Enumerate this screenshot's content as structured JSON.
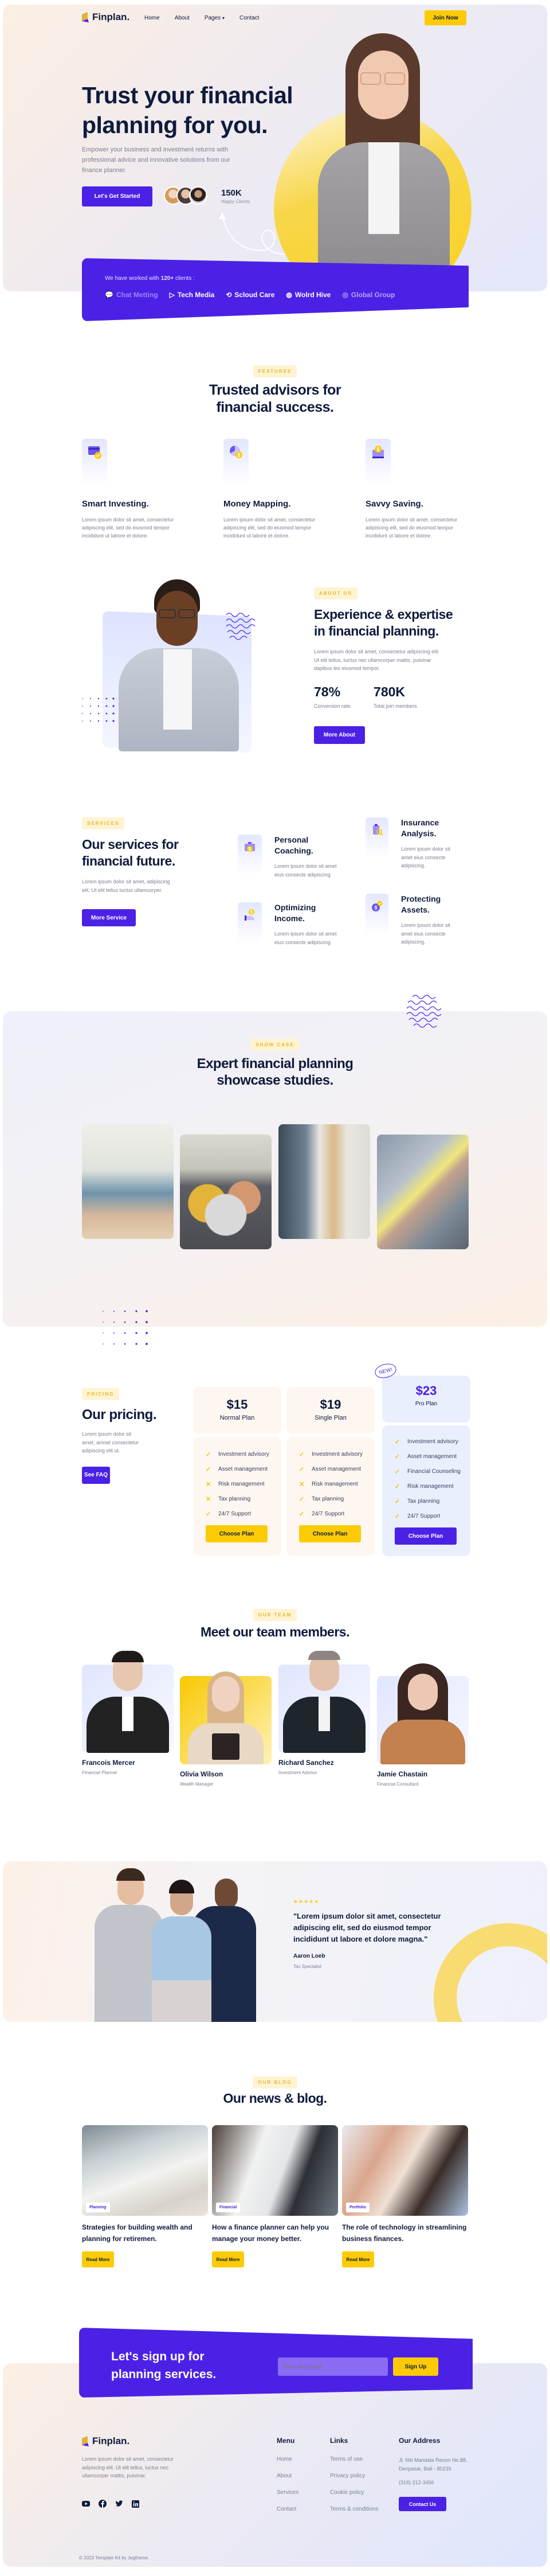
{
  "colors": {
    "primary": "#4b21e6",
    "accent": "#fccb06",
    "navy": "#0f1b3d",
    "muted": "#7b8094",
    "badge_bg": "#fff3d1",
    "badge_text": "#e6b52a"
  },
  "nav": {
    "brand": "Finplan.",
    "links": [
      "Home",
      "About",
      "Pages",
      "Contact"
    ],
    "join_label": "Join Now"
  },
  "hero": {
    "title_line1": "Trust your financial",
    "title_line2": "planning for you.",
    "description": "Empower your business and investment returns with professional advice and innovative solutions from our finance planner.",
    "cta_label": "Let's Get Started",
    "stat_value": "150K",
    "stat_label": "Happy Clients."
  },
  "clients": {
    "intro_prefix": "We have worked with ",
    "intro_count": "120+",
    "intro_suffix": " clients :",
    "logos": [
      {
        "name": "Chat Metting",
        "icon": "chat-bubble-icon"
      },
      {
        "name": "Tech Media",
        "icon": "play-triangle-icon"
      },
      {
        "name": "Scloud Care",
        "icon": "link-swirl-icon"
      },
      {
        "name": "Wolrd Hive",
        "icon": "globe-dots-icon"
      },
      {
        "name": "Global Group",
        "icon": "globe-lines-icon"
      }
    ]
  },
  "features": {
    "badge": "FEATURES",
    "title_line1": "Trusted advisors for",
    "title_line2": "financial success.",
    "items": [
      {
        "title": "Smart Investing.",
        "text": "Lorem ipsum dolor sit amet, consectetur adipiscing elit, sed do eiusmod tempor incididunt ut labore et dolore.",
        "icon": "credit-card-shield-icon"
      },
      {
        "title": "Money Mapping.",
        "text": "Lorem ipsum dolor sit amet, consectetur adipiscing elit, sed do eiusmod tempor incididunt ut labore et dolore.",
        "icon": "pie-chart-coin-icon"
      },
      {
        "title": "Savvy Saving.",
        "text": "Lorem ipsum dolor sit amet, consectetur adipiscing elit, sed do eiusmod tempor incididunt ut labore et dolore.",
        "icon": "wallet-coin-icon"
      }
    ]
  },
  "about": {
    "badge": "ABOUT US",
    "title_line1": "Experience & expertise",
    "title_line2": "in financial planning.",
    "text": "Lorem ipsum dolor sit amet, consectetur adipiscing elit. Ut elit tellus, luctus nec ullamcorper mattis, pulvinar dapibus leo eiusmod tempor.",
    "stats": [
      {
        "value": "78%",
        "label": "Conversion rate."
      },
      {
        "value": "780K",
        "label": "Total join members."
      }
    ],
    "button": "More About"
  },
  "services": {
    "badge": "SERVICES",
    "title_line1": "Our services for",
    "title_line2": "financial future.",
    "text": "Lorem ipsum dolor sit amet, adipiscing elit. Ut elit tellus luctus ullamcorper.",
    "button": "More Service",
    "items": [
      {
        "title_line1": "Personal",
        "title_line2": "Coaching.",
        "text": "Lorem ipsum dolor sit amet eius consecte adipiscing.",
        "icon": "briefcase-coin-icon"
      },
      {
        "title_line1": "Insurance",
        "title_line2": "Analysis.",
        "text": "Lorem ipsum dolor sit amet eius consecte adipiscing.",
        "icon": "document-search-icon"
      },
      {
        "title_line1": "Optimizing",
        "title_line2": "Income.",
        "text": "Lorem ipsum dolor sit amet eius consecte adipiscing.",
        "icon": "hand-coin-icon"
      },
      {
        "title_line1": "Protecting",
        "title_line2": "Assets.",
        "text": "Lorem ipsum dolor sit amet eius consecte adipiscing.",
        "icon": "coin-heart-icon"
      }
    ]
  },
  "showcase": {
    "badge": "SHOW CASE",
    "title_line1": "Expert financial planning",
    "title_line2": "showcase studies."
  },
  "pricing": {
    "badge": "PRICING",
    "title": "Our pricing.",
    "text": "Lorem ipsum dolor sit amet, amnet consectetur adipiscing elit ut.",
    "faq_button": "See FAQ",
    "new_tag": "NEW!",
    "plans": [
      {
        "price": "$15",
        "name": "Normal Plan",
        "button": "Choose Plan",
        "features": [
          {
            "label": "Investment advisory",
            "included": true
          },
          {
            "label": "Asset management",
            "included": true
          },
          {
            "label": "Risk management",
            "included": false
          },
          {
            "label": "Tax planning",
            "included": false
          },
          {
            "label": "24/7 Support",
            "included": true
          }
        ]
      },
      {
        "price": "$19",
        "name": "Single Plan",
        "button": "Choose Plan",
        "features": [
          {
            "label": "Investment advisory",
            "included": true
          },
          {
            "label": "Asset management",
            "included": true
          },
          {
            "label": "Risk management",
            "included": false
          },
          {
            "label": "Tax planning",
            "included": true
          },
          {
            "label": "24/7 Support",
            "included": true
          }
        ]
      },
      {
        "price": "$23",
        "name": "Pro Plan",
        "button": "Choose Plan",
        "features": [
          {
            "label": "Investment advisory",
            "included": true
          },
          {
            "label": "Asset management",
            "included": true
          },
          {
            "label": "Financial Counseling",
            "included": true
          },
          {
            "label": "Risk management",
            "included": true
          },
          {
            "label": "Tax planning",
            "included": true
          },
          {
            "label": "24/7 Support",
            "included": true
          }
        ]
      }
    ]
  },
  "team": {
    "badge": "OUR TEAM",
    "title": "Meet our team members.",
    "members": [
      {
        "name": "Francois Mercer",
        "role": "Financial Planner"
      },
      {
        "name": "Olivia Wilson",
        "role": "Wealth Manager"
      },
      {
        "name": "Richard Sanchez",
        "role": "Investment Advisor"
      },
      {
        "name": "Jamie Chastain",
        "role": "Financial Consultant"
      }
    ]
  },
  "testimonial": {
    "rating": 5,
    "stars": "★★★★★",
    "quote": "\"Lorem ipsum dolor sit amet, consectetur adipiscing elit, sed do eiusmod tempor incididunt ut labore et dolore magna.\"",
    "author": "Aaron Loeb",
    "role": "Tax Specialist"
  },
  "blog": {
    "badge": "OUR BLOG",
    "title": "Our news & blog.",
    "posts": [
      {
        "tag": "Planning",
        "title": "Strategies for building wealth and planning for retiremen.",
        "button": "Read More"
      },
      {
        "tag": "Financial",
        "title": "How a finance planner can help you manage your money better.",
        "button": "Read More"
      },
      {
        "tag": "Portfolio",
        "title": "The role of technology in streamlining business finances.",
        "button": "Read More"
      }
    ]
  },
  "signup": {
    "title_line1": "Let's sign up for",
    "title_line2": "planning services.",
    "email_placeholder": "Enter Your Email",
    "button": "Sign Up"
  },
  "footer": {
    "brand": "Finplan.",
    "about": "Lorem ipsum dolor sit amet, consectetur adipiscing elit. Ut elit tellus, luctus nec ullamcorper mattis, pulvinar.",
    "social": [
      "youtube-icon",
      "facebook-icon",
      "twitter-icon",
      "linkedin-icon"
    ],
    "menu_title": "Menu",
    "menu": [
      "Home",
      "About",
      "Services",
      "Contact"
    ],
    "links_title": "Links",
    "links": [
      "Terms of use",
      "Privacy policy",
      "Cookie policy",
      "Terms & conditions"
    ],
    "address_title": "Our Address",
    "address": "Jl. Niti Mandala Renon No.88, Denpasar, Bali - 80239",
    "phone": "(316) 212-3456",
    "contact_button": "Contact Us",
    "copyright": "© 2023 Template Kit by Jegtheme."
  }
}
